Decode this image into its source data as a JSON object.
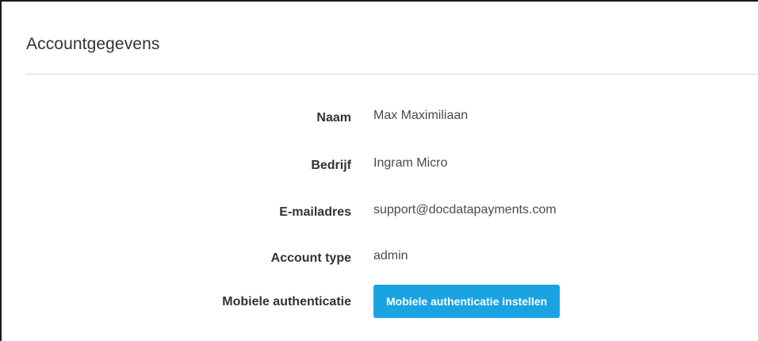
{
  "panel": {
    "title": "Accountgegevens"
  },
  "fields": [
    {
      "label": "Naam",
      "value": "Max Maximiliaan"
    },
    {
      "label": "Bedrijf",
      "value": "Ingram Micro"
    },
    {
      "label": "E-mailadres",
      "value": "support@docdatapayments.com"
    },
    {
      "label": "Account type",
      "value": "admin"
    }
  ],
  "mobile_auth": {
    "label": "Mobiele authenticatie",
    "button_label": "Mobiele authenticatie instellen"
  },
  "colors": {
    "button_bg": "#1aa3e3",
    "button_text": "#ffffff",
    "divider": "#d6d6d6"
  }
}
